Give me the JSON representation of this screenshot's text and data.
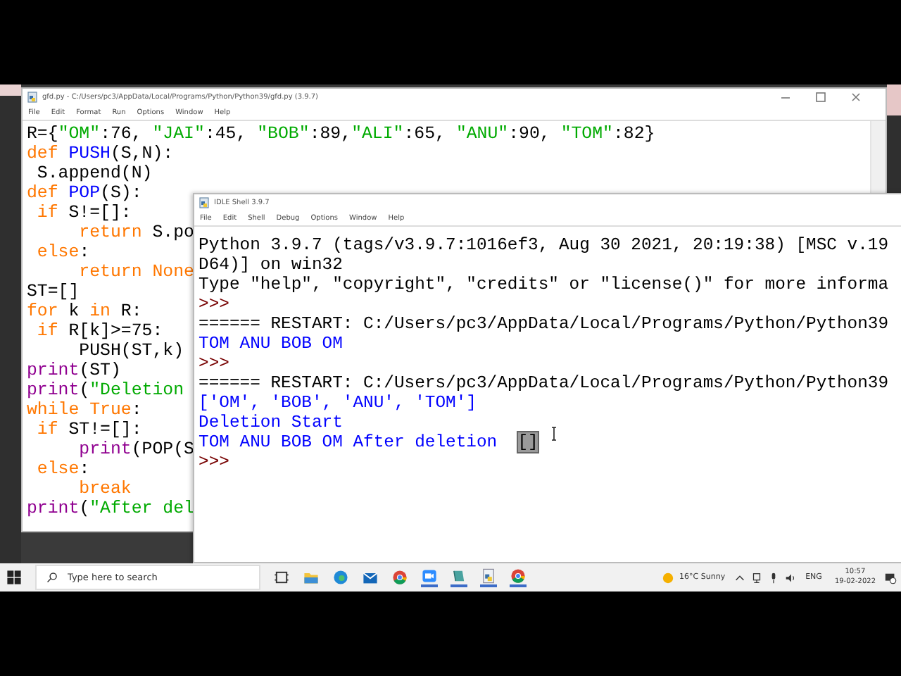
{
  "editor": {
    "title": "gfd.py - C:/Users/pc3/AppData/Local/Programs/Python/Python39/gfd.py (3.9.7)",
    "menu": [
      "File",
      "Edit",
      "Format",
      "Run",
      "Options",
      "Window",
      "Help"
    ],
    "lines": [
      [
        {
          "kind": "plain",
          "text": "R={"
        },
        {
          "kind": "string",
          "text": "\"OM\""
        },
        {
          "kind": "plain",
          "text": ":76, "
        },
        {
          "kind": "string",
          "text": "\"JAI\""
        },
        {
          "kind": "plain",
          "text": ":45, "
        },
        {
          "kind": "string",
          "text": "\"BOB\""
        },
        {
          "kind": "plain",
          "text": ":89,"
        },
        {
          "kind": "string",
          "text": "\"ALI\""
        },
        {
          "kind": "plain",
          "text": ":65, "
        },
        {
          "kind": "string",
          "text": "\"ANU\""
        },
        {
          "kind": "plain",
          "text": ":90, "
        },
        {
          "kind": "string",
          "text": "\"TOM\""
        },
        {
          "kind": "plain",
          "text": ":82}"
        }
      ],
      [
        {
          "kind": "keyword",
          "text": "def"
        },
        {
          "kind": "definition",
          "text": " PUSH"
        },
        {
          "kind": "plain",
          "text": "(S,N):"
        }
      ],
      [
        {
          "kind": "plain",
          "text": " S.append(N)"
        }
      ],
      [
        {
          "kind": "keyword",
          "text": "def"
        },
        {
          "kind": "definition",
          "text": " POP"
        },
        {
          "kind": "plain",
          "text": "(S):"
        }
      ],
      [
        {
          "kind": "keyword",
          "text": " if"
        },
        {
          "kind": "plain",
          "text": " S!=[]:"
        }
      ],
      [
        {
          "kind": "keyword",
          "text": "     return"
        },
        {
          "kind": "plain",
          "text": " S.po"
        }
      ],
      [
        {
          "kind": "keyword",
          "text": " else"
        },
        {
          "kind": "plain",
          "text": ":"
        }
      ],
      [
        {
          "kind": "keyword",
          "text": "     return None"
        }
      ],
      [
        {
          "kind": "plain",
          "text": "ST=[]"
        }
      ],
      [
        {
          "kind": "keyword",
          "text": "for"
        },
        {
          "kind": "plain",
          "text": " k "
        },
        {
          "kind": "keyword",
          "text": "in"
        },
        {
          "kind": "plain",
          "text": " R:"
        }
      ],
      [
        {
          "kind": "keyword",
          "text": " if"
        },
        {
          "kind": "plain",
          "text": " R[k]>=75:"
        }
      ],
      [
        {
          "kind": "plain",
          "text": "     PUSH(ST,k)"
        }
      ],
      [
        {
          "kind": "builtin",
          "text": "print"
        },
        {
          "kind": "plain",
          "text": "(ST)"
        }
      ],
      [
        {
          "kind": "builtin",
          "text": "print"
        },
        {
          "kind": "plain",
          "text": "("
        },
        {
          "kind": "string",
          "text": "\"Deletion"
        }
      ],
      [
        {
          "kind": "keyword",
          "text": "while True"
        },
        {
          "kind": "plain",
          "text": ":"
        }
      ],
      [
        {
          "kind": "keyword",
          "text": " if"
        },
        {
          "kind": "plain",
          "text": " ST!=[]:"
        }
      ],
      [
        {
          "kind": "builtin",
          "text": "     print"
        },
        {
          "kind": "plain",
          "text": "(POP(S"
        }
      ],
      [
        {
          "kind": "keyword",
          "text": " else"
        },
        {
          "kind": "plain",
          "text": ":"
        }
      ],
      [
        {
          "kind": "keyword",
          "text": "     break"
        }
      ],
      [
        {
          "kind": "builtin",
          "text": "print"
        },
        {
          "kind": "plain",
          "text": "("
        },
        {
          "kind": "string",
          "text": "\"After del"
        }
      ]
    ]
  },
  "shell": {
    "title": "IDLE Shell 3.9.7",
    "menu": [
      "File",
      "Edit",
      "Shell",
      "Debug",
      "Options",
      "Window",
      "Help"
    ],
    "lines": [
      [
        {
          "kind": "plain",
          "text": "Python 3.9.7 (tags/v3.9.7:1016ef3, Aug 30 2021, 20:19:38) [MSC v.19"
        }
      ],
      [
        {
          "kind": "plain",
          "text": "D64)] on win32"
        }
      ],
      [
        {
          "kind": "plain",
          "text": "Type \"help\", \"copyright\", \"credits\" or \"license()\" for more informa"
        }
      ],
      [
        {
          "kind": "prompt",
          "text": ">>>"
        }
      ],
      [
        {
          "kind": "plain",
          "text": "====== RESTART: C:/Users/pc3/AppData/Local/Programs/Python/Python39"
        }
      ],
      [
        {
          "kind": "output",
          "text": "TOM ANU BOB OM"
        }
      ],
      [
        {
          "kind": "prompt",
          "text": ">>>"
        }
      ],
      [
        {
          "kind": "plain",
          "text": "====== RESTART: C:/Users/pc3/AppData/Local/Programs/Python/Python39"
        }
      ],
      [
        {
          "kind": "output",
          "text": "['OM', 'BOB', 'ANU', 'TOM']"
        }
      ],
      [
        {
          "kind": "output",
          "text": "Deletion Start"
        }
      ],
      [
        {
          "kind": "output",
          "text": "TOM ANU BOB OM After deletion  "
        },
        {
          "kind": "selected",
          "text": "[]"
        }
      ],
      [
        {
          "kind": "prompt",
          "text": ">>>"
        }
      ]
    ]
  },
  "taskbar": {
    "search": {
      "placeholder": "Type here to search"
    },
    "weather": "16°C  Sunny",
    "language": "ENG",
    "time": "10:57",
    "date": "19-02-2022"
  }
}
